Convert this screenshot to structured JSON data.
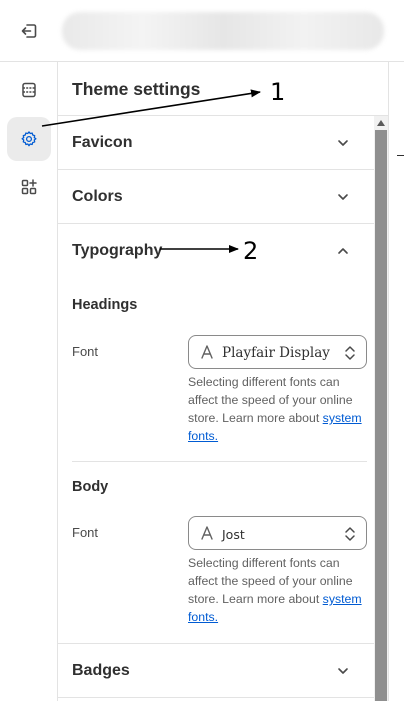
{
  "topbar": {
    "exit_icon": "exit-icon"
  },
  "rail": {
    "items": [
      {
        "icon": "sections-icon",
        "active": false
      },
      {
        "icon": "gear-icon",
        "active": true
      },
      {
        "icon": "apps-add-icon",
        "active": false
      }
    ]
  },
  "panel": {
    "title": "Theme settings",
    "sections": {
      "favicon": {
        "label": "Favicon",
        "expanded": false
      },
      "colors": {
        "label": "Colors",
        "expanded": false
      },
      "typography": {
        "label": "Typography",
        "expanded": true,
        "headings": {
          "title": "Headings",
          "font_label": "Font",
          "font_value": "Playfair Display",
          "help_text": "Selecting different fonts can affect the speed of your online store. Learn more about ",
          "help_link": "system fonts."
        },
        "body": {
          "title": "Body",
          "font_label": "Font",
          "font_value": "Jost",
          "help_text": "Selecting different fonts can affect the speed of your online store. Learn more about ",
          "help_link": "system fonts."
        }
      },
      "badges": {
        "label": "Badges",
        "expanded": false
      }
    }
  },
  "annotations": {
    "label_1": "1",
    "label_2": "2"
  },
  "colors": {
    "link": "#005bd3",
    "active_rail_bg": "#ebebeb",
    "scroll_thumb": "#8f8f8f"
  }
}
